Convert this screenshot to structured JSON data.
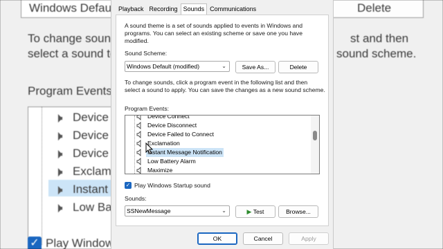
{
  "background": {
    "scheme_value": "Windows Defaul",
    "delete_label": "Delete",
    "desc_line1": "To change sounds",
    "desc_line1b": "st and then",
    "desc_line2": "select a sound to",
    "desc_line2b": "sound scheme.",
    "program_events_label": "Program Events:",
    "events": [
      "Device",
      "Device",
      "Device",
      "Exclama",
      "Instant",
      "Low Bat"
    ],
    "startup_label": "Play Window"
  },
  "tabs": [
    "Playback",
    "Recording",
    "Sounds",
    "Communications"
  ],
  "active_tab": "Sounds",
  "intro_lines": [
    "A sound theme is a set of sounds applied to events in Windows and",
    "programs.  You can select an existing scheme or save one you have",
    "modified."
  ],
  "sound_scheme": {
    "label": "Sound Scheme:",
    "value": "Windows Default (modified)",
    "save_as": "Save As...",
    "delete": "Delete"
  },
  "change_lines": [
    "To change sounds, click a program event in the following list and then",
    "select a sound to apply.  You can save the changes as a new sound scheme."
  ],
  "program_events": {
    "label": "Program Events:",
    "items": [
      "Device Connect",
      "Device Disconnect",
      "Device Failed to Connect",
      "Exclamation",
      "Instant Message Notification",
      "Low Battery Alarm",
      "Maximize"
    ],
    "selected": "Instant Message Notification"
  },
  "startup": {
    "label": "Play Windows Startup sound",
    "checked": true
  },
  "sounds": {
    "label": "Sounds:",
    "value": "SSNewMessage",
    "test": "Test",
    "browse": "Browse..."
  },
  "footer": {
    "ok": "OK",
    "cancel": "Cancel",
    "apply": "Apply"
  },
  "colors": {
    "accent": "#1a66c0",
    "selection": "#cce4f7"
  }
}
